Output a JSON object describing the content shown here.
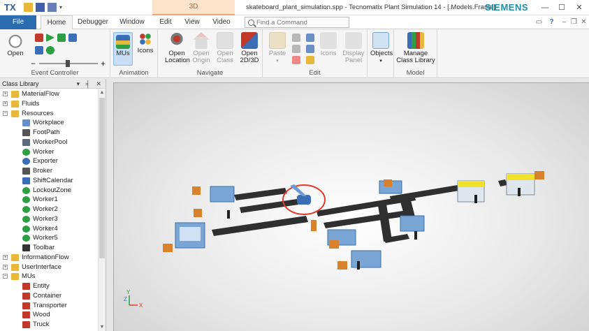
{
  "titlebar": {
    "logo": "TX",
    "context_tab": "3D",
    "window_title": "skateboard_plant_simulation.spp - Tecnomatix Plant Simulation 14 - [.Models.Frame]",
    "brand": "SIEMENS",
    "minimize": "—",
    "maximize": "☐",
    "close": "✕"
  },
  "tabs": {
    "file": "File",
    "home": "Home",
    "debugger": "Debugger",
    "window": "Window",
    "edit": "Edit",
    "view": "View",
    "video": "Video"
  },
  "command_search": {
    "placeholder": "Find a Command"
  },
  "ribbon": {
    "open": "Open",
    "event_controller": "Event Controller",
    "mus": "MUs",
    "icons": "Icons",
    "animation": "Animation",
    "open_location": [
      "Open",
      "Location"
    ],
    "open_origin": [
      "Open",
      "Origin"
    ],
    "open_class": [
      "Open",
      "Class"
    ],
    "open_2d3d": [
      "Open",
      "2D/3D"
    ],
    "navigate": "Navigate",
    "paste": "Paste",
    "edit_icons": "Icons",
    "display_panel": [
      "Display",
      "Panel"
    ],
    "edit": "Edit",
    "objects": "Objects",
    "manage_class_library": [
      "Manage",
      "Class Library"
    ],
    "model": "Model"
  },
  "class_library": {
    "title": "Class Library",
    "head_buttons": "▾ ╡ ✕",
    "items": [
      {
        "label": "MaterialFlow",
        "level": 0,
        "kind": "folder",
        "exp": "+"
      },
      {
        "label": "Fluids",
        "level": 0,
        "kind": "folder",
        "exp": "+"
      },
      {
        "label": "Resources",
        "level": 0,
        "kind": "folder",
        "exp": "−"
      },
      {
        "label": "Workplace",
        "level": 1,
        "kind": "workplace"
      },
      {
        "label": "FootPath",
        "level": 1,
        "kind": "footpath"
      },
      {
        "label": "WorkerPool",
        "level": 1,
        "kind": "workerpool"
      },
      {
        "label": "Worker",
        "level": 1,
        "kind": "worker"
      },
      {
        "label": "Exporter",
        "level": 1,
        "kind": "exporter"
      },
      {
        "label": "Broker",
        "level": 1,
        "kind": "broker"
      },
      {
        "label": "ShiftCalendar",
        "level": 1,
        "kind": "calendar"
      },
      {
        "label": "LockoutZone",
        "level": 1,
        "kind": "worker"
      },
      {
        "label": "Worker1",
        "level": 1,
        "kind": "worker"
      },
      {
        "label": "Worker2",
        "level": 1,
        "kind": "worker"
      },
      {
        "label": "Worker3",
        "level": 1,
        "kind": "worker"
      },
      {
        "label": "Worker4",
        "level": 1,
        "kind": "worker"
      },
      {
        "label": "Worker5",
        "level": 1,
        "kind": "worker"
      },
      {
        "label": "Toolbar",
        "level": 1,
        "kind": "toolbar"
      },
      {
        "label": "InformationFlow",
        "level": 0,
        "kind": "folder",
        "exp": "+"
      },
      {
        "label": "UserInterface",
        "level": 0,
        "kind": "folder",
        "exp": "+"
      },
      {
        "label": "MUs",
        "level": 0,
        "kind": "folder",
        "exp": "−"
      },
      {
        "label": "Entity",
        "level": 1,
        "kind": "entity"
      },
      {
        "label": "Container",
        "level": 1,
        "kind": "entity"
      },
      {
        "label": "Transporter",
        "level": 1,
        "kind": "entity"
      },
      {
        "label": "Wood",
        "level": 1,
        "kind": "entity"
      },
      {
        "label": "Truck",
        "level": 1,
        "kind": "entity"
      }
    ]
  },
  "canvas": {
    "axis_z": "Z",
    "axis_y": "Y",
    "axis_x": "X"
  },
  "colors": {
    "accent": "#2b6cb0",
    "brand": "#1d8fa8",
    "context_tab": "#fde2cc",
    "conveyor": "#2f2f2f",
    "station": "#7aa6d6",
    "yellow_station": "#f2e12b",
    "selection_ring": "#e23a2a"
  }
}
